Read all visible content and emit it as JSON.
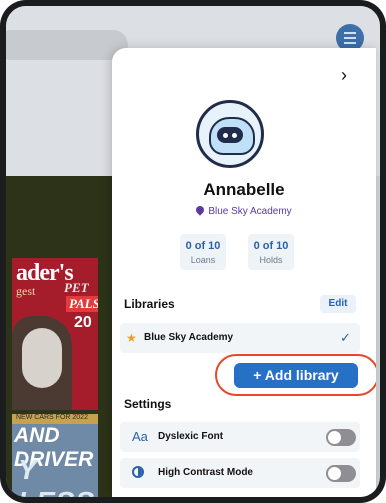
{
  "background": {
    "magazine_top": {
      "title": "ader's",
      "subtitle": "gest",
      "pet": "PET",
      "pals": "PALS",
      "number": "20"
    },
    "magazine_bottom": {
      "strip": "NEW CARS FOR 2022",
      "title": "AND DRIVER",
      "subtitle": "Y LESS"
    }
  },
  "profile": {
    "name": "Annabelle",
    "library": "Blue Sky Academy"
  },
  "stats": [
    {
      "value": "0 of 10",
      "label": "Loans"
    },
    {
      "value": "0 of 10",
      "label": "Holds"
    }
  ],
  "libraries": {
    "heading": "Libraries",
    "edit_label": "Edit",
    "items": [
      {
        "name": "Blue Sky Academy"
      }
    ],
    "add_label": "+ Add library"
  },
  "settings": {
    "heading": "Settings",
    "items": [
      {
        "label": "Dyslexic Font",
        "icon_text": "Aa",
        "enabled": false
      },
      {
        "label": "High Contrast Mode",
        "enabled": false
      }
    ]
  },
  "colors": {
    "accent": "#2670c6",
    "highlight_ring": "#e34a2a",
    "school_text": "#5a3aa0"
  }
}
